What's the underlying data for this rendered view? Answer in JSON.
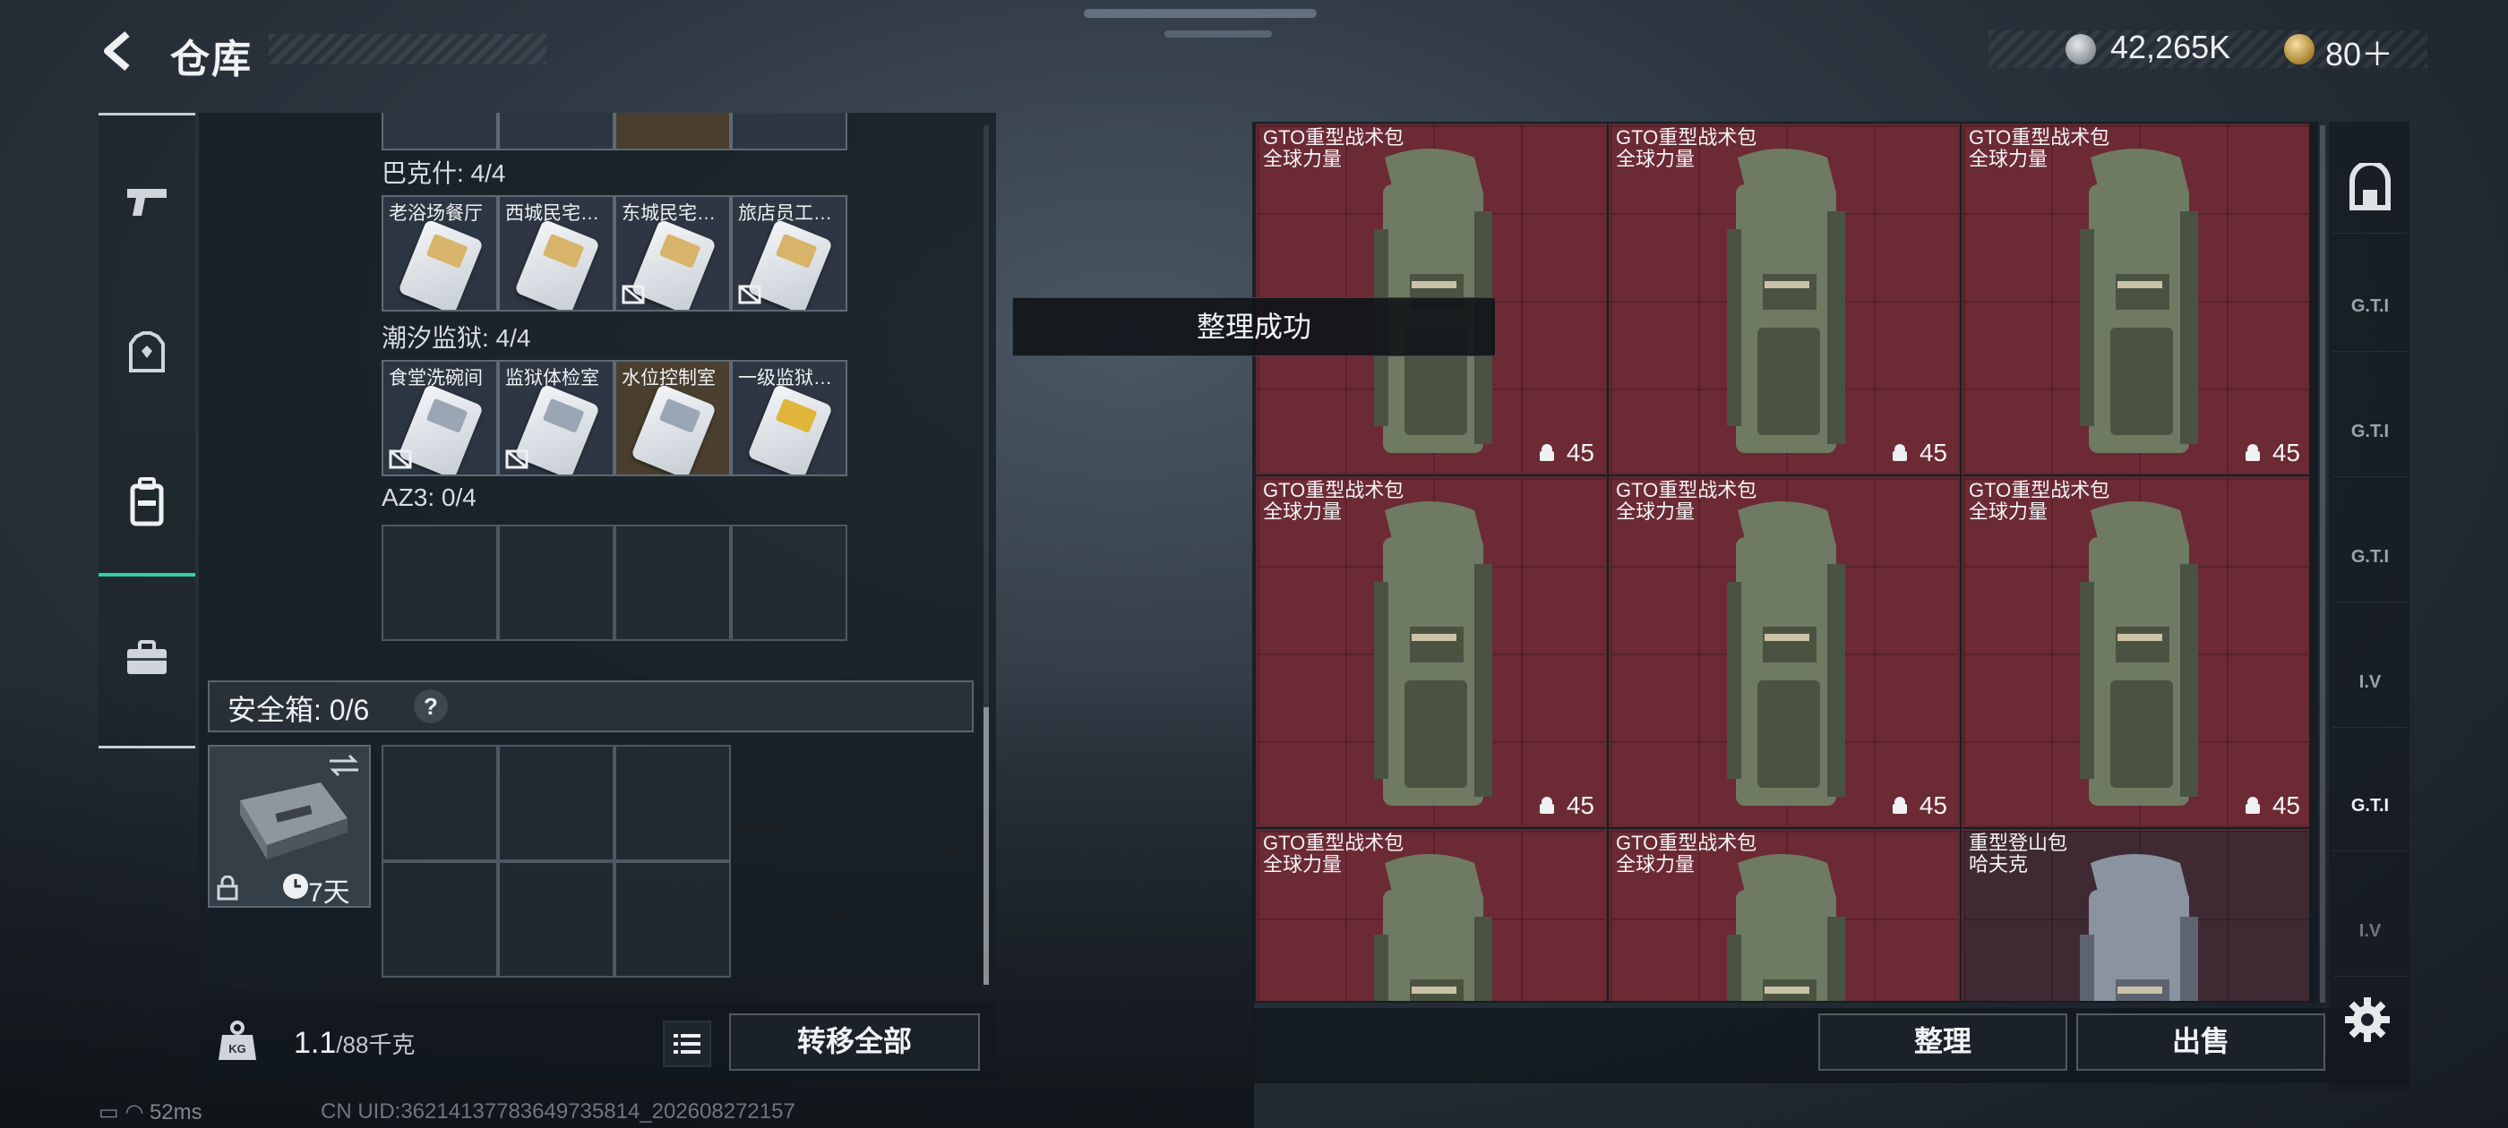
{
  "header": {
    "title": "仓库",
    "currency_silver": "42,265K",
    "currency_gold": "80＋"
  },
  "left_rail": {
    "items": [
      {
        "icon": "pistol-icon"
      },
      {
        "icon": "armor-icon"
      },
      {
        "icon": "backpack-icon",
        "active": true
      },
      {
        "icon": "toolbox-icon"
      }
    ]
  },
  "containers": [
    {
      "label": "巴克什: 4/4",
      "cells": [
        {
          "name": "老浴场餐厅",
          "locked": false
        },
        {
          "name": "西城民宅…",
          "locked": false
        },
        {
          "name": "东城民宅…",
          "locked": true
        },
        {
          "name": "旅店员工…",
          "locked": true
        }
      ]
    },
    {
      "label": "潮汐监狱: 4/4",
      "cells": [
        {
          "name": "食堂洗碗间",
          "locked": true
        },
        {
          "name": "监狱体检室",
          "locked": true
        },
        {
          "name": "水位控制室",
          "locked": false
        },
        {
          "name": "一级监狱…",
          "locked": false
        }
      ]
    },
    {
      "label": "AZ3: 0/4"
    }
  ],
  "safe": {
    "label": "安全箱: 0/6",
    "help": "?",
    "days": "7天"
  },
  "weight": {
    "current": "1.1",
    "max": "/88千克"
  },
  "buttons": {
    "transfer_all": "转移全部",
    "sort": "整理",
    "sell": "出售"
  },
  "toast": "整理成功",
  "items": [
    {
      "name": "GTO重型战术包",
      "sub": "全球力量",
      "count": "45"
    },
    {
      "name": "GTO重型战术包",
      "sub": "全球力量",
      "count": "45"
    },
    {
      "name": "GTO重型战术包",
      "sub": "全球力量",
      "count": "45"
    },
    {
      "name": "GTO重型战术包",
      "sub": "全球力量",
      "count": "45"
    },
    {
      "name": "GTO重型战术包",
      "sub": "全球力量",
      "count": "45"
    },
    {
      "name": "GTO重型战术包",
      "sub": "全球力量",
      "count": "45"
    },
    {
      "name": "GTO重型战术包",
      "sub": "全球力量"
    },
    {
      "name": "GTO重型战术包",
      "sub": "全球力量"
    },
    {
      "name": "重型登山包",
      "sub": "哈夫克"
    }
  ],
  "status": {
    "ping": "52ms",
    "uid": "CN UID:36214137783649735814_202608272157"
  },
  "colors": {
    "accent": "#2fd3a1",
    "item_bg": "#6c2a34"
  }
}
